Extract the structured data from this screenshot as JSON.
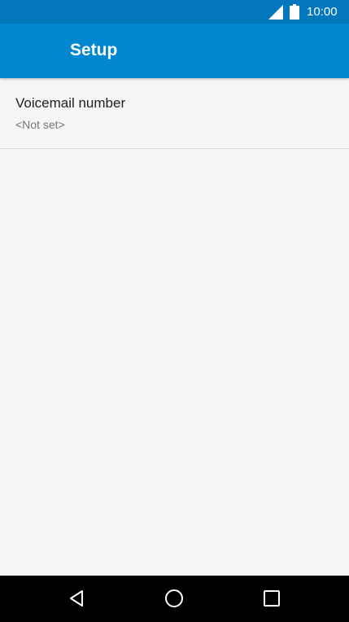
{
  "status_bar": {
    "time": "10:00",
    "icons": [
      "signal-icon",
      "battery-icon"
    ]
  },
  "app_bar": {
    "title": "Setup",
    "color": "#0288d1"
  },
  "preferences": [
    {
      "title": "Voicemail number",
      "summary": "<Not set>"
    }
  ],
  "nav_bar": {
    "buttons": [
      "back-icon",
      "home-icon",
      "recents-icon"
    ]
  },
  "colors": {
    "status_bar": "#0277bd",
    "app_bar": "#0288d1",
    "background": "#f5f5f5",
    "nav_bar": "#000000"
  }
}
